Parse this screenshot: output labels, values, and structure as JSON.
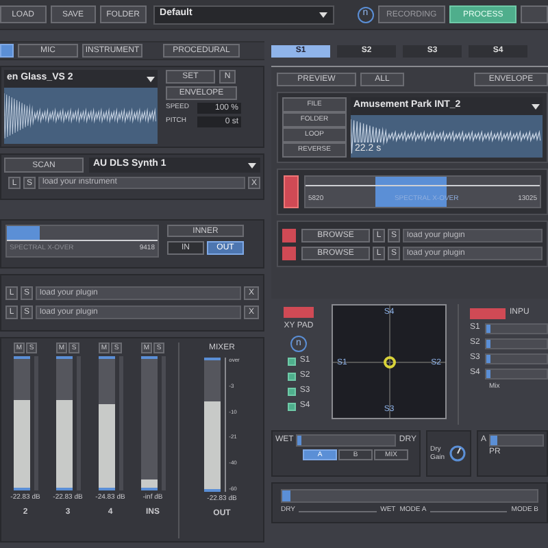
{
  "toolbar": {
    "buttons": [
      "LOAD",
      "SAVE",
      "FOLDER"
    ],
    "preset": "Default",
    "badge": "n",
    "modes": [
      {
        "label": "RECORDING",
        "selected": false
      },
      {
        "label": "PROCESS",
        "selected": true
      }
    ]
  },
  "source_tabs": [
    {
      "selected": true
    },
    {
      "label": "MIC",
      "selected": false
    },
    {
      "label": "INSTRUMENT",
      "selected": false
    },
    {
      "label": "PROCEDURAL",
      "selected": false
    }
  ],
  "slot_tabs": [
    {
      "label": "S1",
      "selected": true
    },
    {
      "label": "S2",
      "selected": false
    },
    {
      "label": "S3",
      "selected": false
    },
    {
      "label": "S4",
      "selected": false
    }
  ],
  "sampler": {
    "file": "en Glass_VS 2",
    "set": "SET",
    "n": "N",
    "envelope": "ENVELOPE",
    "params": [
      {
        "label": "SPEED",
        "value": "100 %"
      },
      {
        "label": "PITCH",
        "value": "0 st"
      }
    ]
  },
  "instrument": {
    "scan": "SCAN",
    "synth": "AU DLS Synth 1",
    "l": "L",
    "s": "S",
    "placeholder": "load your instrument",
    "remove": "X"
  },
  "crossover_left": {
    "label": "SPECTRAL X-OVER",
    "value": "9418",
    "level": 0.22,
    "inner": "INNER",
    "routing": [
      {
        "label": "IN",
        "selected": false
      },
      {
        "label": "OUT",
        "selected": true
      }
    ]
  },
  "left_plugins": [
    {
      "l": "L",
      "s": "S",
      "placeholder": "load your plugin",
      "remove": "X"
    },
    {
      "l": "L",
      "s": "S",
      "placeholder": "load your plugin",
      "remove": "X"
    }
  ],
  "mixer": {
    "title": "MIXER",
    "channels": [
      {
        "name": "2",
        "mute": "M",
        "solo": "S",
        "level": 0.68,
        "reading": "-22.83 dB"
      },
      {
        "name": "3",
        "mute": "M",
        "solo": "S",
        "level": 0.68,
        "reading": "-22.83 dB"
      },
      {
        "name": "4",
        "mute": "M",
        "solo": "S",
        "level": 0.65,
        "reading": "-24.83 dB"
      },
      {
        "name": "INS",
        "mute": "M",
        "solo": "S",
        "level": 0.06,
        "reading": "-inf dB"
      }
    ],
    "out": {
      "name": "OUT",
      "level": 0.68,
      "reading": "-22.83 dB"
    },
    "scale": [
      "over",
      "-3",
      "-10",
      "-21",
      "-40",
      "-60"
    ]
  },
  "preview": {
    "buttons": [
      "PREVIEW",
      "ALL"
    ],
    "envelope": "ENVELOPE"
  },
  "player": {
    "buttons": [
      "FILE",
      "FOLDER",
      "LOOP",
      "REVERSE"
    ],
    "file": "Amusement Park INT_2",
    "duration": "22.2 s"
  },
  "crossover_right": {
    "low": "5820",
    "label": "SPECTRAL X-OVER",
    "high": "13025"
  },
  "right_plugins": [
    {
      "browse": "BROWSE",
      "l": "L",
      "s": "S",
      "placeholder": "load your plugin"
    },
    {
      "browse": "BROWSE",
      "l": "L",
      "s": "S",
      "placeholder": "load your plugin"
    }
  ],
  "xy": {
    "title": "XY PAD",
    "badge": "n",
    "slots": [
      {
        "label": "S1",
        "checked": true
      },
      {
        "label": "S2",
        "checked": true
      },
      {
        "label": "S3",
        "checked": true
      },
      {
        "label": "S4",
        "checked": true
      }
    ],
    "top": "S4",
    "left": "S1",
    "right": "S2",
    "bottom": "S3"
  },
  "input": {
    "title": "INPU",
    "sliders": [
      {
        "label": "S1",
        "level": 0.06
      },
      {
        "label": "S2",
        "level": 0.06
      },
      {
        "label": "S3",
        "level": 0.06
      },
      {
        "label": "S4",
        "level": 0.06
      }
    ],
    "caption": "Mix"
  },
  "wet_dry": {
    "wet": "WET",
    "dry": "DRY",
    "level": 0.03,
    "options": [
      {
        "label": "A",
        "selected": true
      },
      {
        "label": "B",
        "selected": false
      },
      {
        "label": "MIX",
        "selected": false
      }
    ]
  },
  "dry_gain": {
    "label": "Dry Gain"
  },
  "ab": {
    "a": "A",
    "label": "PR",
    "level": 0.12
  },
  "morph": {
    "level": 0.03,
    "labels": [
      "DRY",
      "WET",
      "MODE A",
      "MODE B"
    ]
  }
}
